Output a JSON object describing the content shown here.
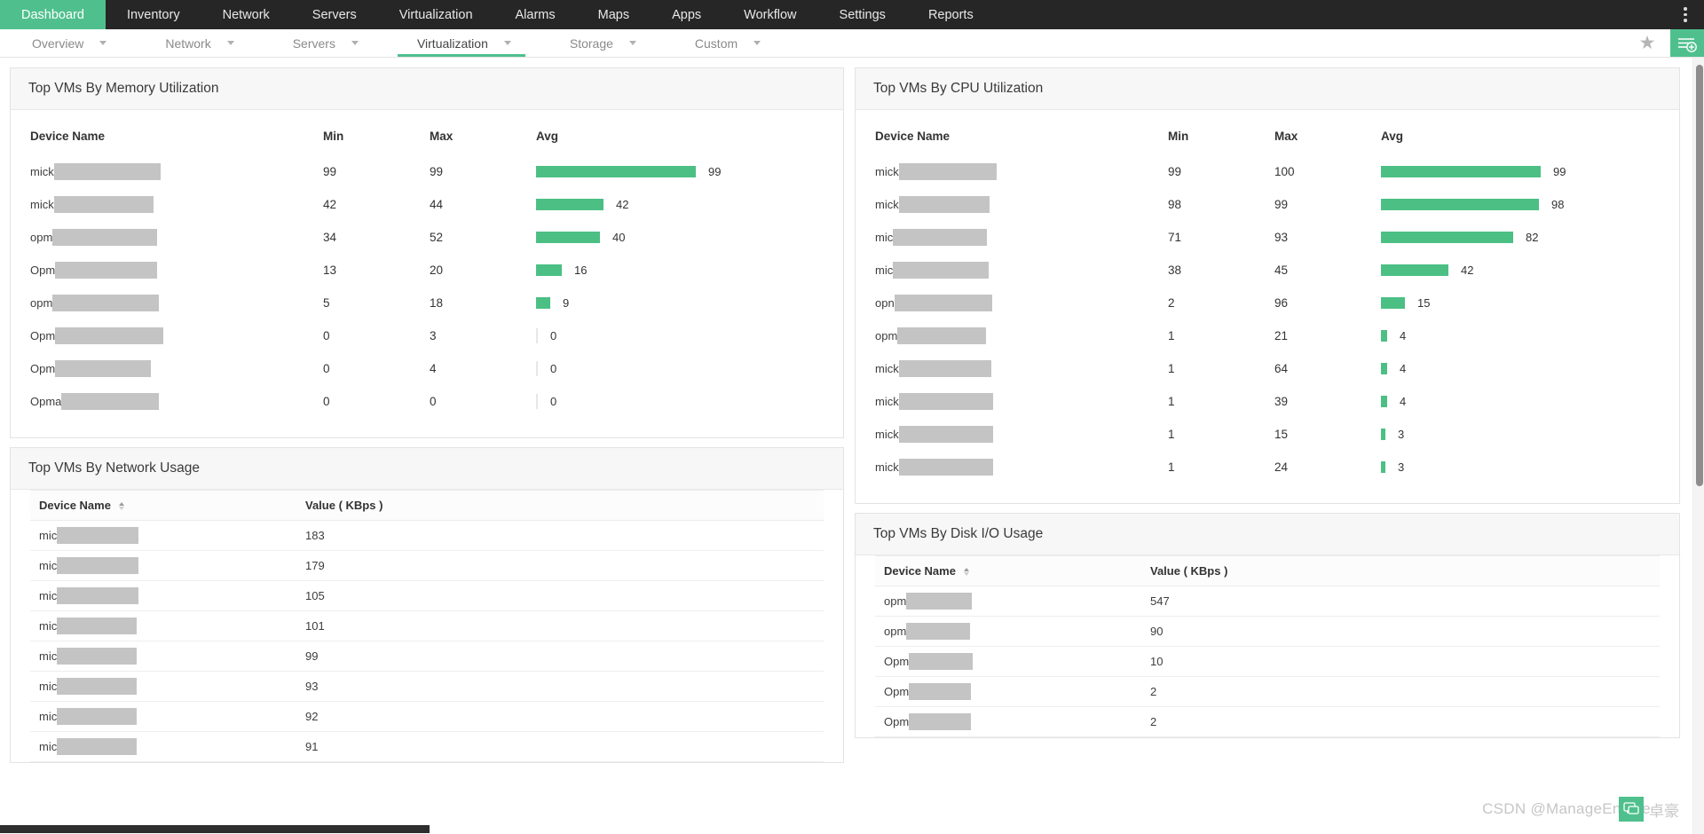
{
  "topnav": {
    "items": [
      {
        "label": "Dashboard",
        "active": true
      },
      {
        "label": "Inventory",
        "active": false
      },
      {
        "label": "Network",
        "active": false
      },
      {
        "label": "Servers",
        "active": false
      },
      {
        "label": "Virtualization",
        "active": false
      },
      {
        "label": "Alarms",
        "active": false
      },
      {
        "label": "Maps",
        "active": false
      },
      {
        "label": "Apps",
        "active": false
      },
      {
        "label": "Workflow",
        "active": false
      },
      {
        "label": "Settings",
        "active": false
      },
      {
        "label": "Reports",
        "active": false
      }
    ],
    "overflow_icon": "kebab-menu-icon"
  },
  "subnav": {
    "items": [
      {
        "label": "Overview",
        "active": false
      },
      {
        "label": "Network",
        "active": false
      },
      {
        "label": "Servers",
        "active": false
      },
      {
        "label": "Virtualization",
        "active": true
      },
      {
        "label": "Storage",
        "active": false
      },
      {
        "label": "Custom",
        "active": false
      }
    ],
    "favorite_icon": "star-icon",
    "add_widget_icon": "add-widget-icon"
  },
  "colors": {
    "accent_green": "#4fc08d",
    "bar_green": "#4cbf85",
    "topnav_dark": "#262626",
    "redaction_gray": "#c4c4c4"
  },
  "panels": {
    "memory": {
      "title": "Top VMs By Memory Utilization",
      "columns": [
        "Device Name",
        "Min",
        "Max",
        "Avg"
      ],
      "rows": [
        {
          "name_prefix": "mick",
          "redact_w": 120,
          "min": "99",
          "max": "99",
          "avg": "99",
          "bar_pct": 100
        },
        {
          "name_prefix": "mick",
          "redact_w": 112,
          "min": "42",
          "max": "44",
          "avg": "42",
          "bar_pct": 42
        },
        {
          "name_prefix": "opm",
          "redact_w": 118,
          "min": "34",
          "max": "52",
          "avg": "40",
          "bar_pct": 40
        },
        {
          "name_prefix": "Opm",
          "redact_w": 115,
          "min": "13",
          "max": "20",
          "avg": "16",
          "bar_pct": 16
        },
        {
          "name_prefix": "opm",
          "redact_w": 120,
          "min": "5",
          "max": "18",
          "avg": "9",
          "bar_pct": 9
        },
        {
          "name_prefix": "Opm",
          "redact_w": 122,
          "min": "0",
          "max": "3",
          "avg": "0",
          "bar_pct": 0
        },
        {
          "name_prefix": "Opm",
          "redact_w": 108,
          "min": "0",
          "max": "4",
          "avg": "0",
          "bar_pct": 0
        },
        {
          "name_prefix": "Opma",
          "redact_w": 110,
          "min": "0",
          "max": "0",
          "avg": "0",
          "bar_pct": 0
        }
      ]
    },
    "cpu": {
      "title": "Top VMs By CPU Utilization",
      "columns": [
        "Device Name",
        "Min",
        "Max",
        "Avg"
      ],
      "rows": [
        {
          "name_prefix": "mick",
          "redact_w": 110,
          "min": "99",
          "max": "100",
          "avg": "99",
          "bar_pct": 99
        },
        {
          "name_prefix": "mick",
          "redact_w": 102,
          "min": "98",
          "max": "99",
          "avg": "98",
          "bar_pct": 98
        },
        {
          "name_prefix": "mic",
          "redact_w": 106,
          "min": "71",
          "max": "93",
          "avg": "82",
          "bar_pct": 82
        },
        {
          "name_prefix": "mic",
          "redact_w": 108,
          "min": "38",
          "max": "45",
          "avg": "42",
          "bar_pct": 42
        },
        {
          "name_prefix": "opn",
          "redact_w": 110,
          "min": "2",
          "max": "96",
          "avg": "15",
          "bar_pct": 15
        },
        {
          "name_prefix": "opm",
          "redact_w": 100,
          "min": "1",
          "max": "21",
          "avg": "4",
          "bar_pct": 4
        },
        {
          "name_prefix": "mick",
          "redact_w": 104,
          "min": "1",
          "max": "64",
          "avg": "4",
          "bar_pct": 4
        },
        {
          "name_prefix": "mick",
          "redact_w": 106,
          "min": "1",
          "max": "39",
          "avg": "4",
          "bar_pct": 4
        },
        {
          "name_prefix": "mick",
          "redact_w": 106,
          "min": "1",
          "max": "15",
          "avg": "3",
          "bar_pct": 3
        },
        {
          "name_prefix": "mick",
          "redact_w": 106,
          "min": "1",
          "max": "24",
          "avg": "3",
          "bar_pct": 3
        }
      ]
    },
    "network": {
      "title": "Top VMs By Network Usage",
      "columns": [
        "Device Name",
        "Value ( KBps )"
      ],
      "sort_column": "Device Name",
      "rows": [
        {
          "name_prefix": "mic",
          "redact_w": 92,
          "value": "183"
        },
        {
          "name_prefix": "mic",
          "redact_w": 92,
          "value": "179"
        },
        {
          "name_prefix": "mic",
          "redact_w": 92,
          "value": "105"
        },
        {
          "name_prefix": "mic",
          "redact_w": 90,
          "value": "101"
        },
        {
          "name_prefix": "mic",
          "redact_w": 90,
          "value": "99"
        },
        {
          "name_prefix": "mic",
          "redact_w": 90,
          "value": "93"
        },
        {
          "name_prefix": "mic",
          "redact_w": 90,
          "value": "92"
        },
        {
          "name_prefix": "mic",
          "redact_w": 90,
          "value": "91"
        }
      ]
    },
    "disk": {
      "title": "Top VMs By Disk I/O Usage",
      "columns": [
        "Device Name",
        "Value ( KBps )"
      ],
      "sort_column": "Device Name",
      "rows": [
        {
          "name_prefix": "opm",
          "redact_w": 74,
          "value": "547"
        },
        {
          "name_prefix": "opm",
          "redact_w": 72,
          "value": "90"
        },
        {
          "name_prefix": "Opm",
          "redact_w": 72,
          "value": "10"
        },
        {
          "name_prefix": "Opm",
          "redact_w": 70,
          "value": "2"
        },
        {
          "name_prefix": "Opm",
          "redact_w": 70,
          "value": "2"
        }
      ]
    }
  },
  "watermark": {
    "text": "CSDN @ManageEngine",
    "cn": "卓豪"
  }
}
